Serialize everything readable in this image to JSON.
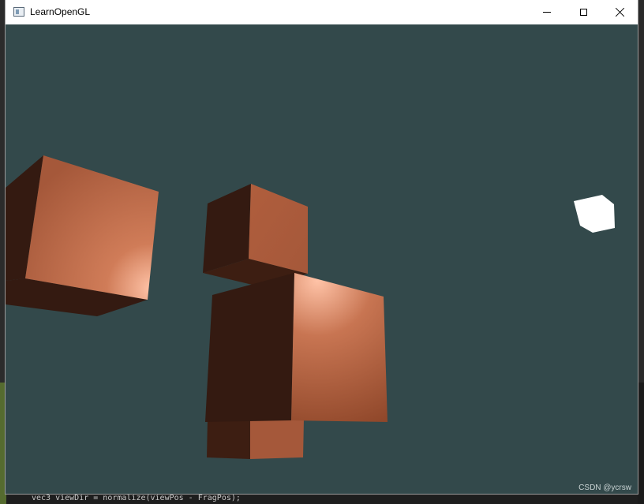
{
  "window": {
    "title": "LearnOpenGL",
    "controls": {
      "minimize_icon": "minimize-icon",
      "maximize_icon": "maximize-icon",
      "close_icon": "close-icon"
    }
  },
  "viewport": {
    "clear_color": "#33494b",
    "cube_lit_color": "#a5583a",
    "cube_highlight_color": "#ffc3a7",
    "cube_shadow_color": "#341a11",
    "light_cube_color": "#ffffff"
  },
  "watermark": "CSDN @ycrsw",
  "background_editor_line": "vec3 viewDir = normalize(viewPos - FragPos);"
}
